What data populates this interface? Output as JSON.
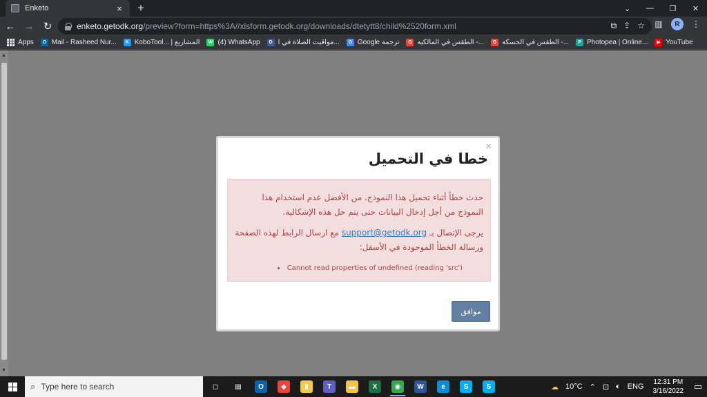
{
  "browser": {
    "tab_title": "Enketo",
    "tab_close": "×",
    "new_tab": "+",
    "url_host": "enketo.getodk.org",
    "url_path": "/preview?form=https%3A//xlsform.getodk.org/downloads/dtetytt8/child%2520form.xml",
    "profile_initial": "R"
  },
  "bookmarks": [
    {
      "label": "Apps",
      "icon": "apps-grid-icon"
    },
    {
      "label": "Mail - Rasheed Nur...",
      "icon": "outlook-icon",
      "color": "#0a64ad",
      "glyph": "O"
    },
    {
      "label": "KoboTool... | المشاريع",
      "icon": "kobo-icon",
      "color": "#2196f3",
      "glyph": "K"
    },
    {
      "label": "(4) WhatsApp",
      "icon": "whatsapp-icon",
      "color": "#25d366",
      "glyph": "W"
    },
    {
      "label": "مواقيت الصلاة في ا...",
      "icon": "prayer-times-icon",
      "color": "#3b5998",
      "glyph": "D"
    },
    {
      "label": "Google ترجمة",
      "icon": "google-translate-icon",
      "color": "#4285f4",
      "glyph": "G"
    },
    {
      "label": "الطقس في المالكية -...",
      "icon": "google-icon",
      "color": "#ea4335",
      "glyph": "G"
    },
    {
      "label": "الطقس في الحسكة -...",
      "icon": "google-icon",
      "color": "#ea4335",
      "glyph": "G"
    },
    {
      "label": "Photopea | Online...",
      "icon": "photopea-icon",
      "color": "#18a497",
      "glyph": "P"
    },
    {
      "label": "YouTube",
      "icon": "youtube-icon",
      "color": "#ff0000",
      "glyph": "▶"
    }
  ],
  "modal": {
    "close": "×",
    "title": "خطا في التحميل",
    "message_1": "حدث خطأ أثناء تحميل هذا النموذج. من الأفضل عدم استخدام هذا النموذج من أجل إدخال البيانات حتى يتم حل هذه الإشكالية.",
    "message_2_prefix": "يرجى الإتصال بـ",
    "support_email": "support@getodk.org",
    "message_2_suffix": "مع ارسال الرابط لهذه الصفحة ورسالة الخطأ الموجودة في الأسفل:",
    "error_item": "Cannot read properties of undefined (reading 'src')",
    "ok_button": "موافق"
  },
  "taskbar": {
    "search_placeholder": "Type here to search",
    "weather": "10°C",
    "language": "ENG",
    "time": "12:31 PM",
    "date": "3/16/2022",
    "apps": [
      {
        "name": "task-view",
        "color": "#1c1c1c",
        "glyph": "◻"
      },
      {
        "name": "widgets",
        "color": "#1c1c1c",
        "glyph": "▤"
      },
      {
        "name": "outlook",
        "color": "#0a64ad",
        "glyph": "O"
      },
      {
        "name": "anydesk",
        "color": "#ef443b",
        "glyph": "◆"
      },
      {
        "name": "sticky-notes",
        "color": "#f7c948",
        "glyph": "▮"
      },
      {
        "name": "teams",
        "color": "#5b5fc7",
        "glyph": "T"
      },
      {
        "name": "file-explorer",
        "color": "#f5c342",
        "glyph": "▬"
      },
      {
        "name": "excel",
        "color": "#1d6f42",
        "glyph": "X"
      },
      {
        "name": "chrome",
        "color": "#34a853",
        "glyph": "◉"
      },
      {
        "name": "word",
        "color": "#2b579a",
        "glyph": "W"
      },
      {
        "name": "edge",
        "color": "#0c8dd6",
        "glyph": "e"
      },
      {
        "name": "skype",
        "color": "#00aff0",
        "glyph": "S"
      },
      {
        "name": "skype-2",
        "color": "#00aff0",
        "glyph": "S"
      }
    ]
  }
}
